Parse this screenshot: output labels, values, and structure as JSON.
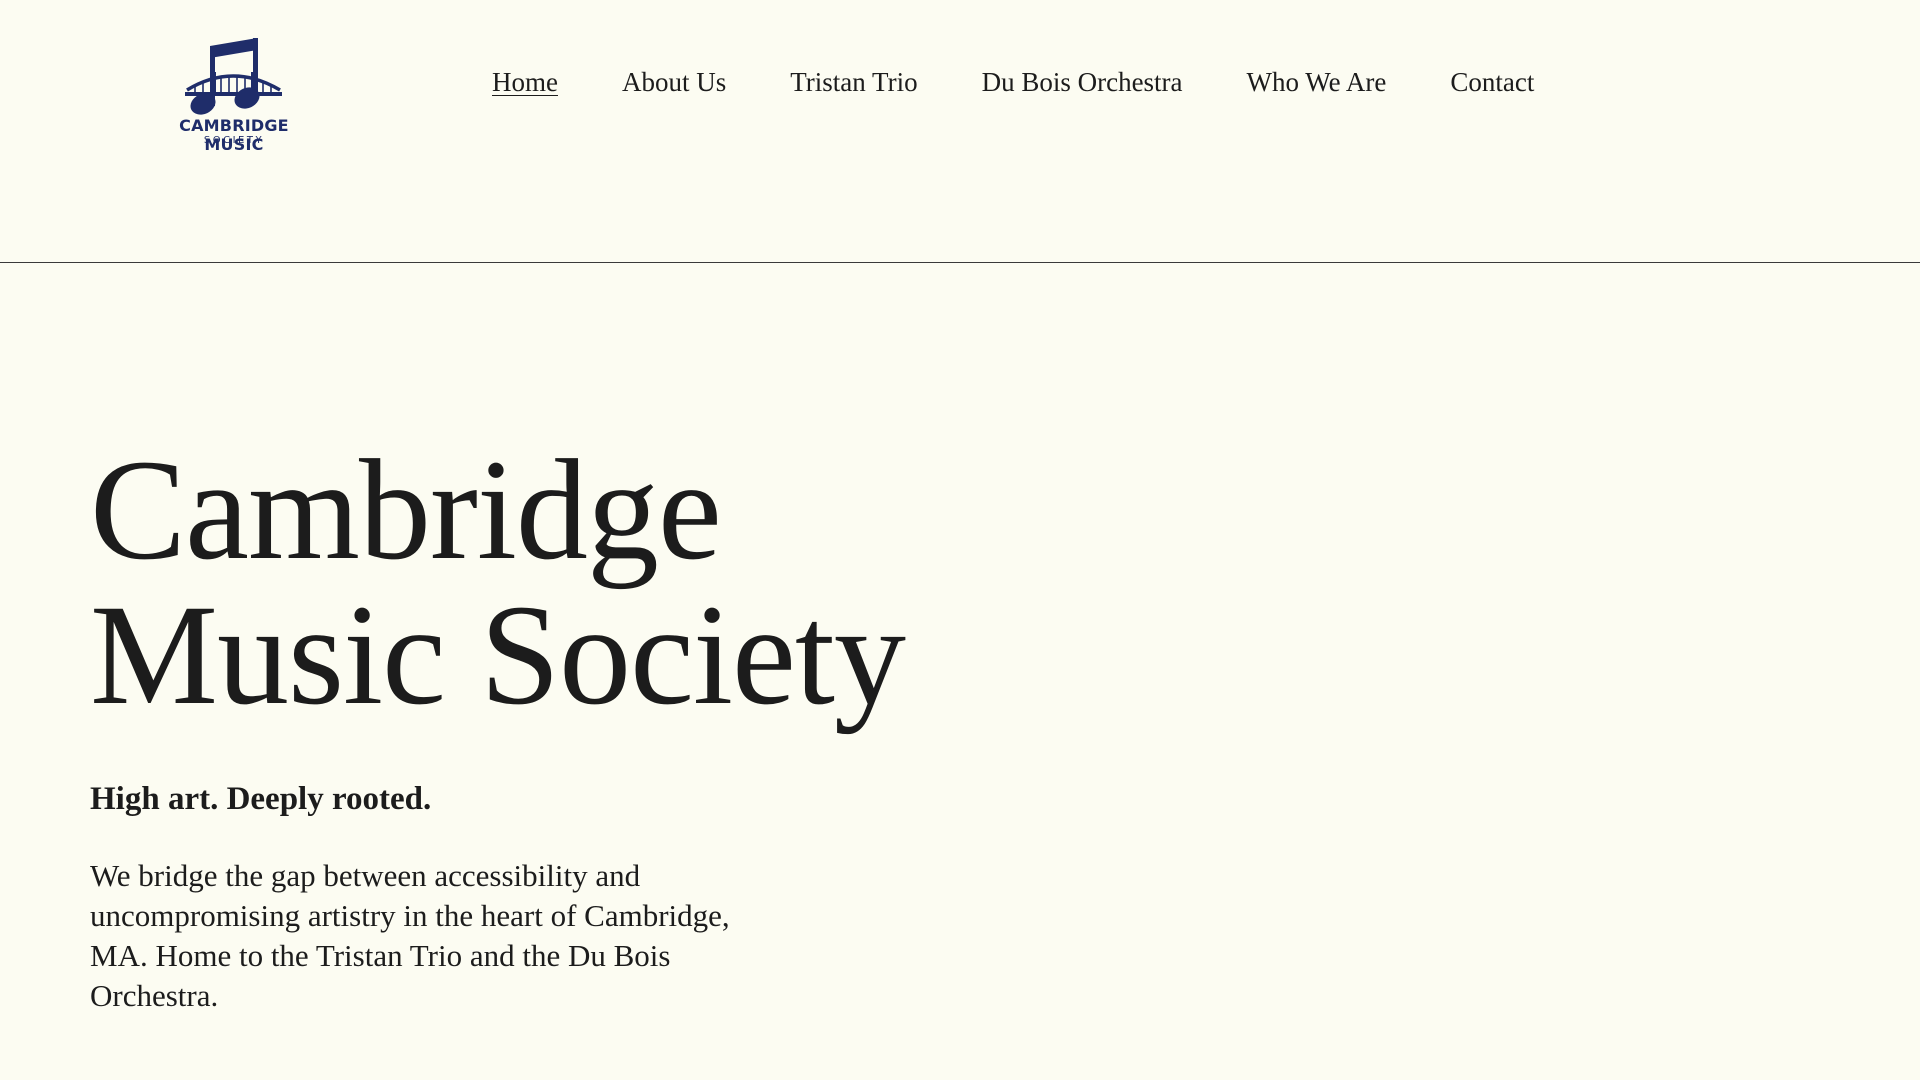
{
  "colors": {
    "background": "#fcfcf2",
    "text": "#1c1c1c",
    "brand": "#1f2d6a",
    "divider": "#3a3a3a"
  },
  "logo": {
    "icon": "music-note-bridge-icon",
    "name": "CAMBRIDGE MUSIC",
    "subname": "SOCIETY"
  },
  "nav": {
    "items": [
      {
        "label": "Home",
        "active": true
      },
      {
        "label": "About Us"
      },
      {
        "label": "Tristan Trio"
      },
      {
        "label": "Du Bois Orchestra"
      },
      {
        "label": "Who We Are"
      },
      {
        "label": "Contact"
      }
    ]
  },
  "hero": {
    "title_line1": "Cambridge",
    "title_line2": "Music Society",
    "tagline": "High art. Deeply rooted.",
    "description": "We bridge the gap between accessibility and uncompromising artistry in the heart of Cambridge, MA. Home to the Tristan Trio and the Du Bois Orchestra."
  }
}
